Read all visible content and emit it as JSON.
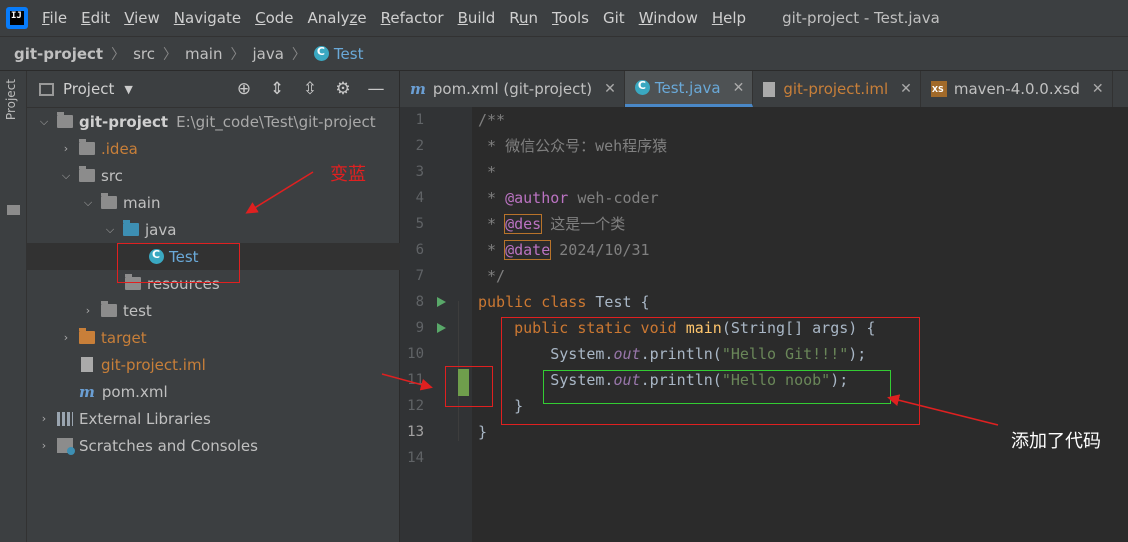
{
  "menu": {
    "items": [
      {
        "pre": "",
        "mn": "F",
        "post": "ile"
      },
      {
        "pre": "",
        "mn": "E",
        "post": "dit"
      },
      {
        "pre": "",
        "mn": "V",
        "post": "iew"
      },
      {
        "pre": "",
        "mn": "N",
        "post": "avigate"
      },
      {
        "pre": "",
        "mn": "C",
        "post": "ode"
      },
      {
        "pre": "Analy",
        "mn": "z",
        "post": "e"
      },
      {
        "pre": "",
        "mn": "R",
        "post": "efactor"
      },
      {
        "pre": "",
        "mn": "B",
        "post": "uild"
      },
      {
        "pre": "R",
        "mn": "u",
        "post": "n"
      },
      {
        "pre": "",
        "mn": "T",
        "post": "ools"
      },
      {
        "pre": "Git",
        "mn": "",
        "post": ""
      },
      {
        "pre": "",
        "mn": "W",
        "post": "indow"
      },
      {
        "pre": "",
        "mn": "H",
        "post": "elp"
      }
    ],
    "window_title": "git-project - Test.java"
  },
  "breadcrumbs": [
    "git-project",
    "src",
    "main",
    "java",
    "Test"
  ],
  "project_panel": {
    "strip_label": "Project",
    "title": "Project",
    "tree": {
      "root_name": "git-project",
      "root_path": "E:\\git_code\\Test\\git-project",
      "idea": ".idea",
      "src": "src",
      "main": "main",
      "java": "java",
      "test_class": "Test",
      "resources": "resources",
      "test": "test",
      "target": "target",
      "iml": "git-project.iml",
      "pom": "pom.xml",
      "external": "External Libraries",
      "scratches": "Scratches and Consoles"
    }
  },
  "tabs": [
    {
      "label": "pom.xml (git-project)"
    },
    {
      "label": "Test.java"
    },
    {
      "label": "git-project.iml"
    },
    {
      "label": "maven-4.0.0.xsd"
    }
  ],
  "editor": {
    "line_numbers": [
      "1",
      "2",
      "3",
      "4",
      "5",
      "6",
      "7",
      "8",
      "9",
      "10",
      "11",
      "12",
      "13",
      "14"
    ],
    "code": {
      "l1": "/**",
      "l2": " * 微信公众号：weh程序猿",
      "l3": " *",
      "l4_pre": " * ",
      "l4_tag": "@author",
      "l4_post": " weh-coder",
      "l5_pre": " * ",
      "l5_tag": "@des",
      "l5_post": " 这是一个类",
      "l6_pre": " * ",
      "l6_tag": "@date",
      "l6_post": " 2024/10/31",
      "l7": " */",
      "l8_kw": "public class ",
      "l8_name": "Test",
      "l8_post": " {",
      "l9_indent": "    ",
      "l9_kw": "public static void ",
      "l9_fn": "main",
      "l9_post": "(String[] ",
      "l9_arg": "args",
      "l9_end": ") {",
      "l10_indent": "        ",
      "l10_cls": "System.",
      "l10_fld": "out",
      "l10_call": ".println(",
      "l10_str": "\"Hello Git!!!\"",
      "l10_end": ");",
      "l11_indent": "        ",
      "l11_cls": "System.",
      "l11_fld": "out",
      "l11_call": ".println(",
      "l11_str": "\"Hello noob\"",
      "l11_end": ");",
      "l12": "    }",
      "l13": "}"
    }
  },
  "annotations": {
    "turn_blue": "变蓝",
    "added_code": "添加了代码",
    "red": "#e02020",
    "green": "#33cc33"
  }
}
